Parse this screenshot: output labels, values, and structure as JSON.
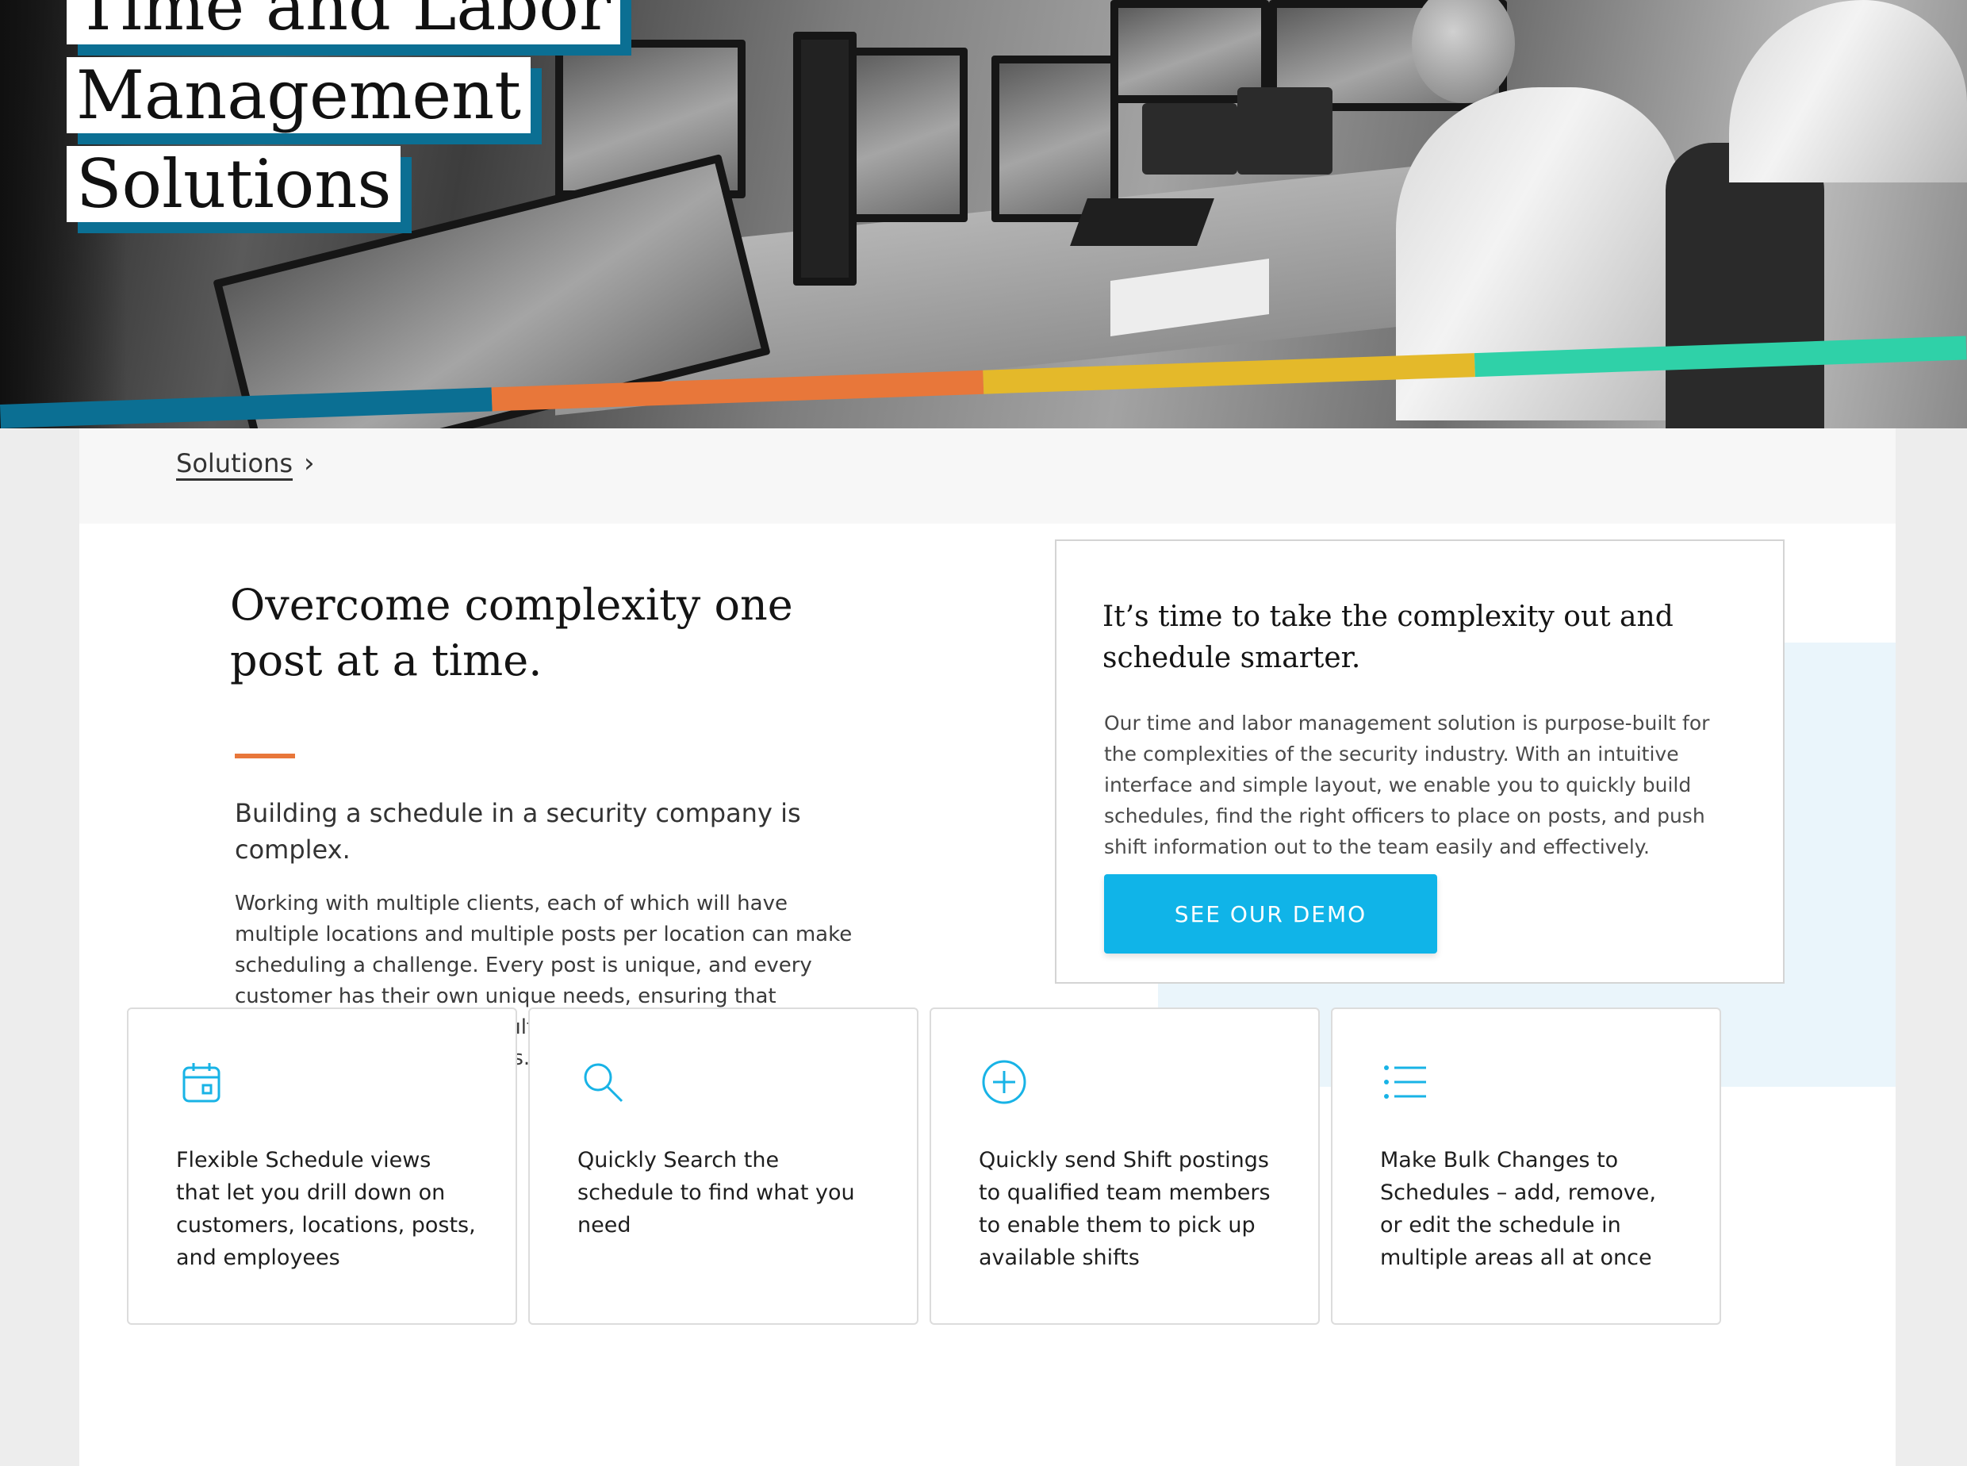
{
  "hero": {
    "title_lines": [
      "Time and Labor",
      "Management",
      "Solutions"
    ],
    "stripe_colors": [
      "#0b6f93",
      "#e8773a",
      "#e4b92a",
      "#2fd1a8"
    ]
  },
  "breadcrumb": {
    "link": "Solutions",
    "separator_icon": "chevron-right-icon"
  },
  "intro": {
    "heading": "Overcome complexity one post at a time.",
    "accent_color": "#e8773a",
    "lead": "Building a schedule in a security company is complex.",
    "body": "Working with multiple clients, each of which will have multiple locations and multiple posts per location can make scheduling a challenge.  Every post is unique, and every customer has their own unique needs, ensuring that schedules are set up and fulfilled each week can be time-consuming for any business."
  },
  "demo_card": {
    "title": "It’s time to take the complexity out and schedule smarter.",
    "text": "Our time and labor management solution is purpose-built for the complexities of the security industry. With an intuitive interface and simple layout, we enable you to quickly build schedules, find the right officers to place on posts, and push shift information out to the team easily and effectively.",
    "button_label": "SEE OUR DEMO",
    "button_color": "#10b4e8"
  },
  "features": [
    {
      "icon": "calendar-icon",
      "text": "Flexible Schedule views that let you drill down on customers, locations, posts, and employees"
    },
    {
      "icon": "search-icon",
      "text": "Quickly Search the schedule to find what you need"
    },
    {
      "icon": "plus-circle-icon",
      "text": "Quickly send Shift postings to qualified team members to enable them to pick up available shifts"
    },
    {
      "icon": "list-icon",
      "text": "Make Bulk Changes to Schedules – add, remove, or edit the schedule in multiple areas all at once"
    }
  ]
}
